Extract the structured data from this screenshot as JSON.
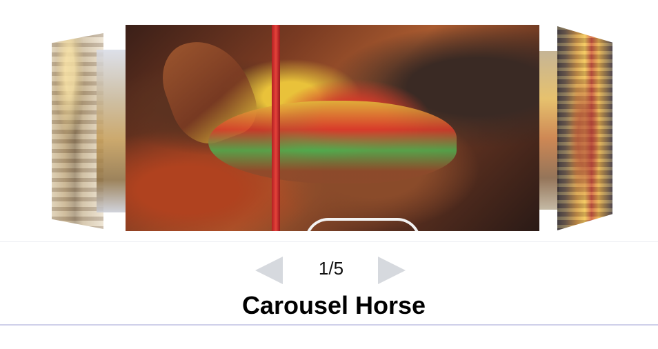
{
  "carousel": {
    "current_index": 1,
    "total": 5,
    "counter_text": "1/5",
    "current_title": "Carousel Horse",
    "prev_icon": "triangle-left-icon",
    "next_icon": "triangle-right-icon"
  },
  "colors": {
    "arrow": "#d6d9de",
    "divider": "#cfd0ea",
    "background": "#ffffff"
  }
}
